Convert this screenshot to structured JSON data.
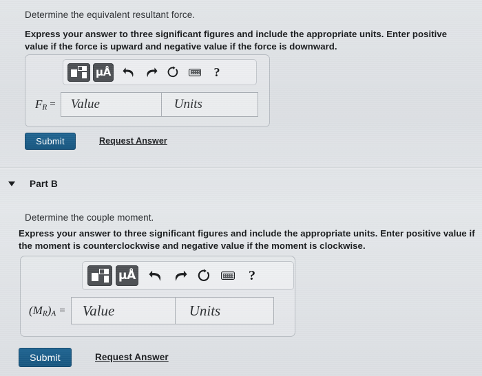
{
  "part_a": {
    "prompt": "Determine the equivalent resultant force.",
    "instruction": "Express your answer to three significant figures and include the appropriate units. Enter positive value if the force is upward and negative value if the force is downward.",
    "toolbar": {
      "template_icon": "template-matrix-icon",
      "units_label": "μÅ",
      "undo_icon": "undo-arrow-icon",
      "redo_icon": "redo-arrow-icon",
      "reset_icon": "reset-circular-arrow-icon",
      "keyboard_icon": "keyboard-icon",
      "help_label": "?"
    },
    "variable_label": "F",
    "variable_sub": "R",
    "equals": "=",
    "value_placeholder": "Value",
    "units_placeholder": "Units",
    "value_text": "",
    "units_text": "",
    "submit_label": "Submit",
    "request_answer_label": "Request Answer"
  },
  "part_b": {
    "header_title": "Part B",
    "caret_icon": "chevron-down-icon",
    "prompt": "Determine the couple moment.",
    "instruction": "Express your answer to three significant figures and include the appropriate units. Enter positive value if the moment is counterclockwise and negative value if the moment is clockwise.",
    "toolbar": {
      "template_icon": "template-matrix-icon",
      "units_label": "μÅ",
      "undo_icon": "undo-arrow-icon",
      "redo_icon": "redo-arrow-icon",
      "reset_icon": "reset-circular-arrow-icon",
      "keyboard_icon": "keyboard-icon",
      "help_label": "?"
    },
    "variable_open": "(",
    "variable_label": "M",
    "variable_sub": "R",
    "variable_close": ")",
    "variable_sub2": "A",
    "equals": "=",
    "value_placeholder": "Value",
    "units_placeholder": "Units",
    "value_text": "",
    "units_text": "",
    "submit_label": "Submit",
    "request_answer_label": "Request Answer"
  },
  "colors": {
    "page_background": "#dfe2e5",
    "submit_blue": "#1a5d8a",
    "panel_border": "#b7bcc2",
    "toolbar_dark": "#4c4f53",
    "text_primary": "#17191b"
  }
}
